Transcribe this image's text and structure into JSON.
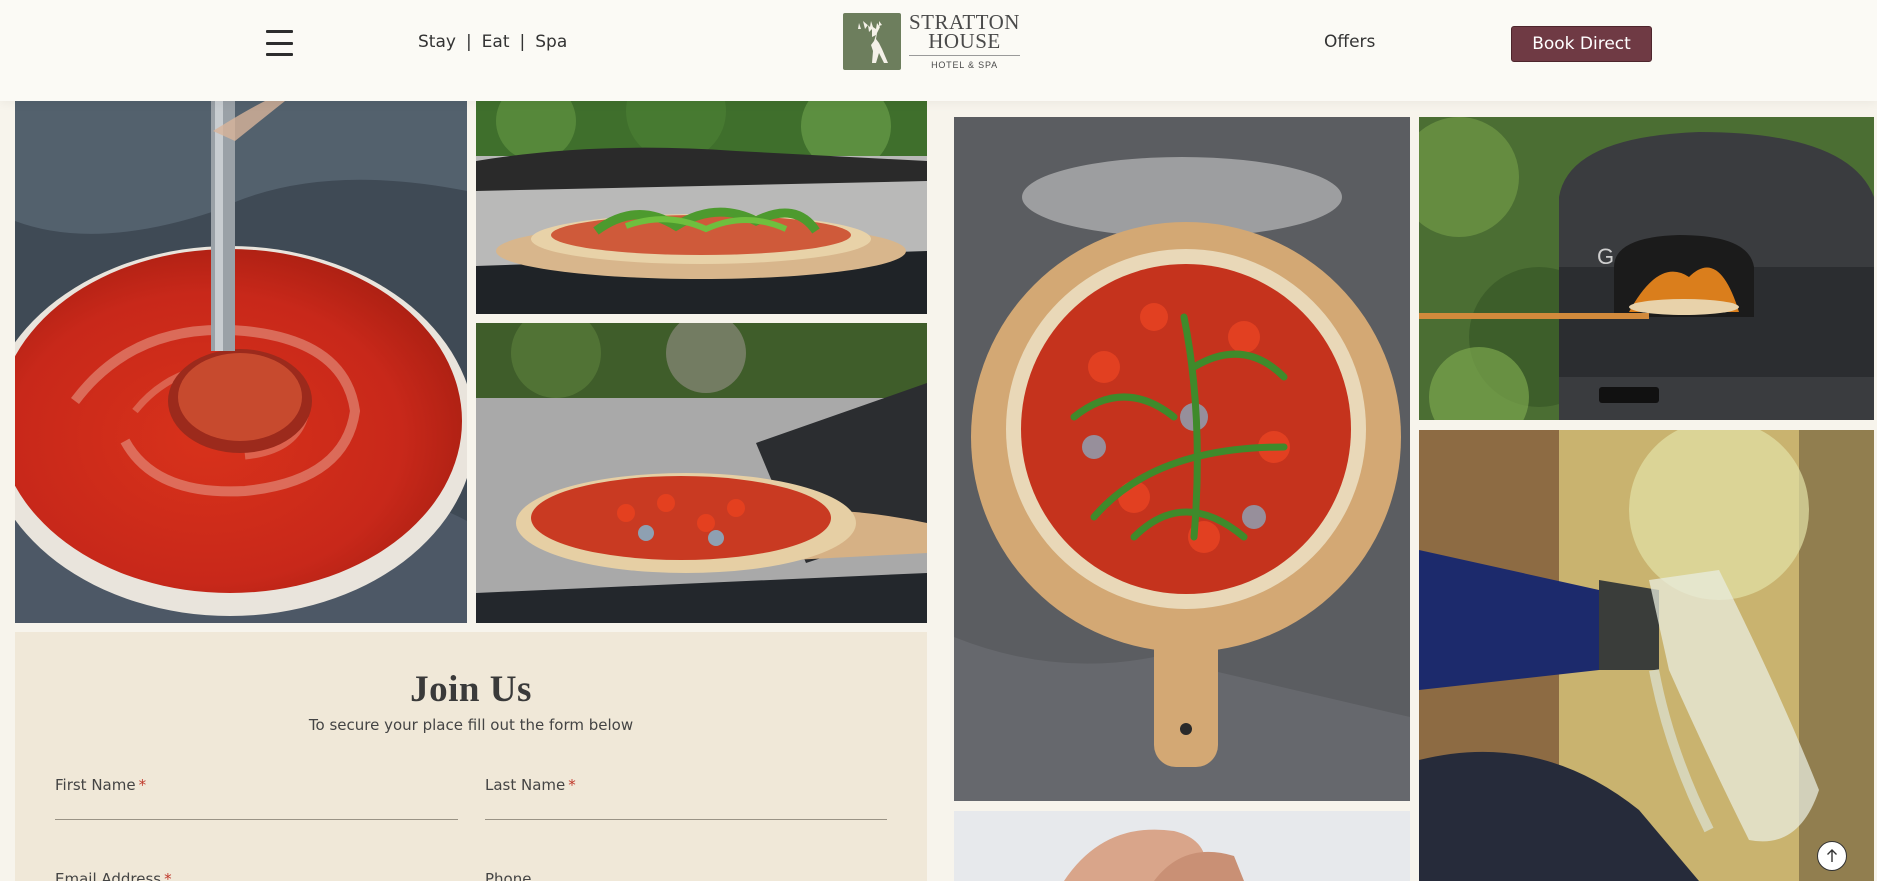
{
  "header": {
    "nav_links": [
      {
        "label": "Stay"
      },
      {
        "label": "Eat"
      },
      {
        "label": "Spa"
      }
    ],
    "nav_separator": "|",
    "logo": {
      "name_line1": "STRATTON",
      "name_line2": "HOUSE",
      "subtitle": "HOTEL & SPA",
      "icon": "stag-icon"
    },
    "offers_label": "Offers",
    "book_label": "Book Direct",
    "menu_icon": "hamburger-menu-icon"
  },
  "gallery": {
    "images": [
      {
        "subject": "pizza-sauce-ladle"
      },
      {
        "subject": "pizza-on-wooden-peel"
      },
      {
        "subject": "pizza-with-metal-peel"
      },
      {
        "subject": "pizza-on-wooden-board"
      },
      {
        "subject": "pizza-oven"
      },
      {
        "subject": "prosecco-pour"
      },
      {
        "subject": "chef-hands"
      }
    ]
  },
  "join": {
    "title": "Join Us",
    "subtitle": "To secure your place fill out the form below",
    "fields": {
      "first_name": {
        "label": "First Name",
        "required_mark": "*",
        "value": ""
      },
      "last_name": {
        "label": "Last Name",
        "required_mark": "*",
        "value": ""
      },
      "email": {
        "label": "Email Address",
        "required_mark": "*",
        "value": ""
      },
      "phone": {
        "label": "Phone",
        "value": ""
      }
    }
  },
  "scroll_top_icon": "arrow-up-icon",
  "colors": {
    "accent_button": "#6f3a44",
    "logo_green": "#6d7e5d",
    "panel_bg": "#f0e8d8",
    "required": "#c0392b"
  }
}
